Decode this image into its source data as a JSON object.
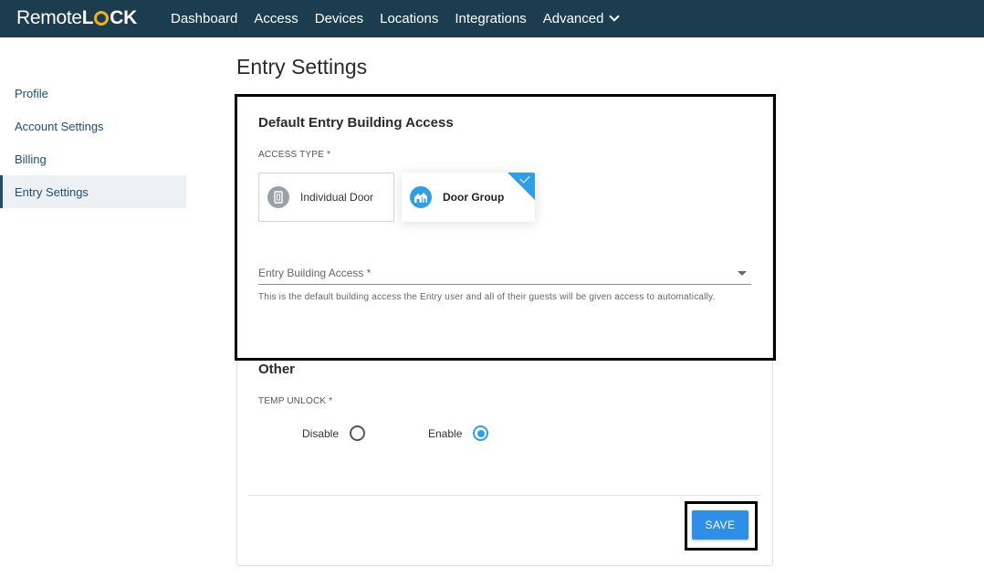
{
  "brand": {
    "logo_part1": "Remote",
    "logo_part2_a": "L",
    "logo_part2_b": "CK",
    "accent_color": "#f2b01e",
    "nav_bg": "#1b3d4f"
  },
  "nav": {
    "items": [
      {
        "label": "Dashboard"
      },
      {
        "label": "Access"
      },
      {
        "label": "Devices"
      },
      {
        "label": "Locations"
      },
      {
        "label": "Integrations"
      },
      {
        "label": "Advanced",
        "icon": "chevron-down-icon"
      }
    ]
  },
  "sidebar": {
    "items": [
      {
        "label": "Profile"
      },
      {
        "label": "Account Settings"
      },
      {
        "label": "Billing"
      },
      {
        "label": "Entry Settings",
        "active": true
      }
    ]
  },
  "page": {
    "title": "Entry Settings"
  },
  "building_access": {
    "title": "Default Entry Building Access",
    "access_type_label": "ACCESS TYPE *",
    "options": [
      {
        "label": "Individual Door",
        "icon": "door-icon",
        "selected": false
      },
      {
        "label": "Door Group",
        "icon": "door-group-icon",
        "selected": true
      }
    ],
    "select_placeholder": "Entry Building Access *",
    "helper_text": "This is the default building access the Entry user and all of their guests will be given access to automatically."
  },
  "other": {
    "title": "Other",
    "temp_unlock_label": "TEMP UNLOCK *",
    "radios": [
      {
        "label": "Disable",
        "selected": false
      },
      {
        "label": "Enable",
        "selected": true
      }
    ]
  },
  "actions": {
    "save_label": "SAVE",
    "primary_color": "#2f8ee6"
  }
}
